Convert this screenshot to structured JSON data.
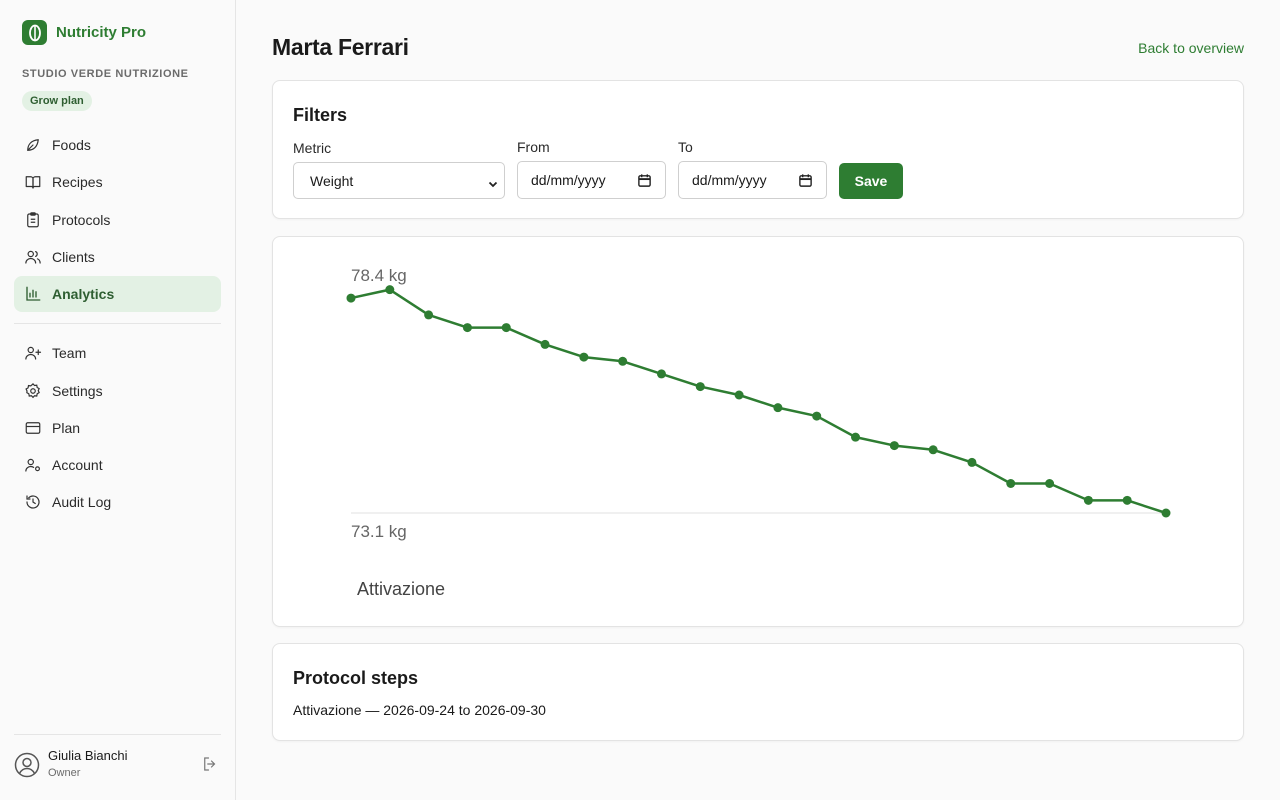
{
  "app": {
    "name": "Nutricity Pro",
    "org": "STUDIO VERDE NUTRIZIONE",
    "plan_badge": "Grow plan",
    "brand_color": "#2e7d32"
  },
  "nav": {
    "primary": [
      {
        "label": "Foods",
        "icon": "leaf-icon"
      },
      {
        "label": "Recipes",
        "icon": "book-icon"
      },
      {
        "label": "Protocols",
        "icon": "clipboard-icon"
      },
      {
        "label": "Clients",
        "icon": "users-icon"
      },
      {
        "label": "Analytics",
        "icon": "bar-chart-icon",
        "active": true
      }
    ],
    "secondary": [
      {
        "label": "Team",
        "icon": "user-plus-icon"
      },
      {
        "label": "Settings",
        "icon": "gear-icon"
      },
      {
        "label": "Plan",
        "icon": "credit-card-icon"
      },
      {
        "label": "Account",
        "icon": "user-cog-icon"
      },
      {
        "label": "Audit Log",
        "icon": "history-icon"
      }
    ]
  },
  "user": {
    "name": "Giulia Bianchi",
    "role": "Owner"
  },
  "page": {
    "title": "Marta Ferrari",
    "back_link": "Back to overview"
  },
  "filters": {
    "title": "Filters",
    "metric_label": "Metric",
    "metric_value": "Weight",
    "from_label": "From",
    "from_placeholder": "dd/mm/yyyy",
    "to_label": "To",
    "to_placeholder": "dd/mm/yyyy",
    "save_label": "Save"
  },
  "chart_data": {
    "type": "line",
    "x": [
      1,
      2,
      3,
      4,
      5,
      6,
      7,
      8,
      9,
      10,
      11,
      12,
      13,
      14,
      15,
      16,
      17,
      18,
      19,
      20,
      21,
      22
    ],
    "series": [
      {
        "values": [
          77.9,
          78.1,
          77.5,
          77.2,
          77.2,
          76.8,
          76.5,
          76.4,
          76.1,
          75.8,
          75.6,
          75.3,
          75.1,
          74.6,
          74.4,
          74.3,
          74.0,
          73.5,
          73.5,
          73.1,
          73.1,
          72.8
        ]
      }
    ],
    "max_label": "78.4 kg",
    "min_label": "73.1 kg",
    "ylim": [
      72.8,
      78.4
    ],
    "band_label": "Attivazione",
    "line_color": "#2e7d32",
    "grid": false
  },
  "steps": {
    "title": "Protocol steps",
    "items": [
      {
        "text": "Attivazione — 2026-09-24 to 2026-09-30"
      }
    ]
  }
}
